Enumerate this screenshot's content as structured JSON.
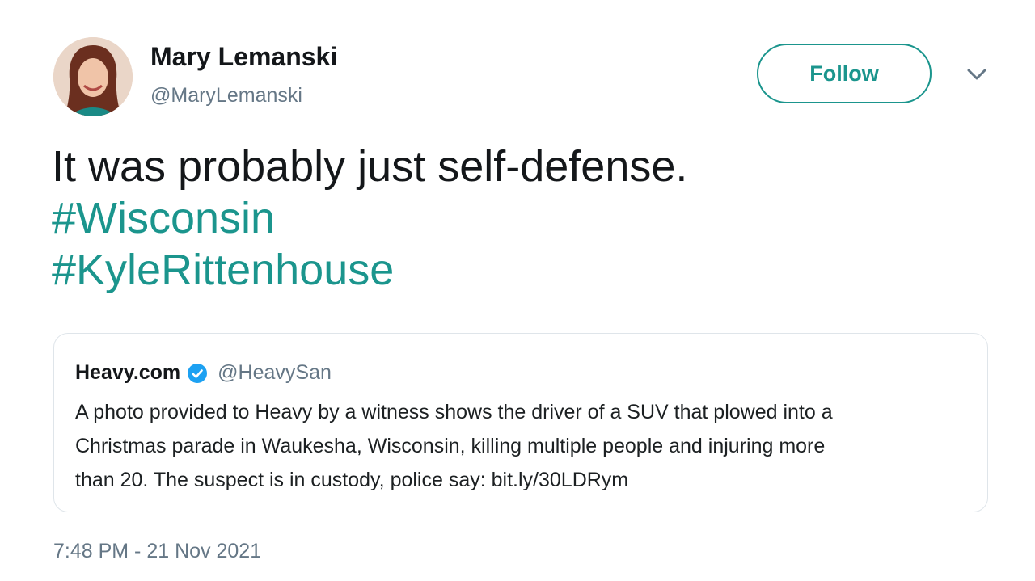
{
  "author": {
    "display_name": "Mary Lemanski",
    "handle": "@MaryLemanski",
    "avatar_icon": "profile-photo"
  },
  "actions": {
    "follow_label": "Follow",
    "menu_icon": "chevron-down-icon"
  },
  "tweet": {
    "text_line_1": "It was probably just self-defense.",
    "hashtag_1": "#Wisconsin",
    "hashtag_2": "#KyleRittenhouse"
  },
  "quoted_tweet": {
    "name": "Heavy.com",
    "verified_icon": "verified-badge-icon",
    "handle": "@HeavySan",
    "text_line_1": "A photo provided to Heavy by a witness shows the driver of a SUV that plowed into a",
    "text_line_2": "Christmas parade in Waukesha, Wisconsin, killing multiple people and injuring more",
    "text_line_3": "than 20. The suspect is in custody, police say: bit.ly/30LDRym"
  },
  "timestamp": "7:48 PM - 21 Nov 2021",
  "colors": {
    "accent": "#1b958d",
    "verified": "#1da1f2",
    "secondary_text": "#657786"
  }
}
